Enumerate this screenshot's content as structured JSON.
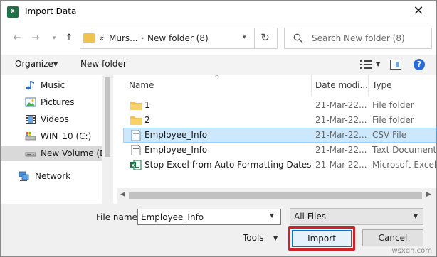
{
  "window": {
    "title": "Import Data",
    "app_icon_letter": "X"
  },
  "address": {
    "segments": [
      "«",
      "Murs...",
      "New folder (8)"
    ]
  },
  "search": {
    "placeholder": "Search New folder (8)"
  },
  "toolbar": {
    "organize_label": "Organize",
    "new_folder_label": "New folder"
  },
  "nav": {
    "items": [
      {
        "label": "Music",
        "icon": "music-icon"
      },
      {
        "label": "Pictures",
        "icon": "pictures-icon"
      },
      {
        "label": "Videos",
        "icon": "videos-icon"
      },
      {
        "label": "WIN_10 (C:)",
        "icon": "drive-icon"
      },
      {
        "label": "New Volume (D:)",
        "icon": "drive-icon"
      },
      {
        "label": "Network",
        "icon": "network-icon"
      }
    ]
  },
  "columns": {
    "name": "Name",
    "date": "Date modi...",
    "type": "Type"
  },
  "files": [
    {
      "name": "1",
      "date": "21-Mar-22...",
      "type": "File folder",
      "icon": "folder-icon"
    },
    {
      "name": "2",
      "date": "21-Mar-22...",
      "type": "File folder",
      "icon": "folder-icon"
    },
    {
      "name": "Employee_Info",
      "date": "21-Mar-22...",
      "type": "CSV File",
      "icon": "csv-file-icon"
    },
    {
      "name": "Employee_Info",
      "date": "21-Mar-22...",
      "type": "Text Document",
      "icon": "text-file-icon"
    },
    {
      "name": "Stop Excel from Auto Formatting Dates",
      "date": "21-Mar-22...",
      "type": "Microsoft Excel W...",
      "icon": "excel-file-icon"
    }
  ],
  "bottom": {
    "file_name_label": "File name:",
    "file_name_value": "Employee_Info",
    "filter_label": "All Files",
    "tools_label": "Tools",
    "import_label": "Import",
    "cancel_label": "Cancel"
  },
  "watermark": "wsxdn.com",
  "colors": {
    "accent": "#0078d7",
    "selection": "#cce8ff",
    "highlight": "#d0202a",
    "excel": "#1e7145"
  }
}
